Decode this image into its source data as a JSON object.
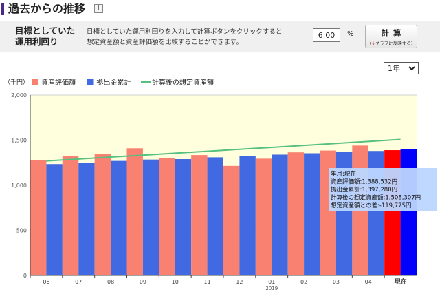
{
  "header": {
    "title": "過去からの推移",
    "info_icon": "info-icon",
    "info_glyph": "i"
  },
  "calculator": {
    "label_line1": "目標としていた",
    "label_line2": "運用利回り",
    "description_line1": "目標としていた運用利回りを入力して計算ボタンをクリックすると",
    "description_line2": "想定資産額と資産評価額を比較することができます。",
    "rate_value": "6.00",
    "rate_unit": "%",
    "button_label": "計算",
    "button_sub_arrow": "↓",
    "button_sub": "グラフに反映する"
  },
  "period": {
    "selected": "1年"
  },
  "chart_data": {
    "type": "bar",
    "unit_label": "（千円）",
    "legend": [
      {
        "name": "資産評価額",
        "color": "#f98172",
        "kind": "bar"
      },
      {
        "name": "拠出金累計",
        "color": "#4169e1",
        "kind": "bar"
      },
      {
        "name": "計算後の想定資産額",
        "color": "#55c080",
        "kind": "line"
      }
    ],
    "categories": [
      "06",
      "07",
      "08",
      "09",
      "10",
      "11",
      "12",
      "01",
      "02",
      "03",
      "04",
      "現在"
    ],
    "year_label": "2019",
    "year_label_index": 7,
    "series": [
      {
        "name": "資産評価額",
        "values": [
          1275,
          1325,
          1345,
          1410,
          1300,
          1335,
          1215,
          1295,
          1365,
          1385,
          1440,
          1389
        ]
      },
      {
        "name": "拠出金累計",
        "values": [
          1235,
          1250,
          1270,
          1285,
          1290,
          1310,
          1325,
          1340,
          1355,
          1370,
          1380,
          1397
        ]
      },
      {
        "name": "計算後の想定資産額",
        "values": [
          1270,
          1291,
          1313,
          1334,
          1356,
          1377,
          1399,
          1420,
          1442,
          1464,
          1486,
          1508
        ]
      }
    ],
    "highlight_index": 11,
    "highlight_colors": {
      "bar1": "#ff0000",
      "bar2": "#0000ff"
    },
    "y_ticks": [
      "0",
      "500",
      "1,000",
      "1,500",
      "2,000"
    ],
    "ylim": [
      0,
      2000
    ],
    "plot_background": "#ffffdd",
    "grid": true,
    "tooltip": {
      "lines": [
        "年月:現在",
        "資産評価額:1,388,532円",
        "拠出金累計:1,397,280円",
        "計算後の想定資産額:1,508,307円",
        "想定資産額との差:-119,775円"
      ],
      "background": "#bcd6ff"
    }
  }
}
